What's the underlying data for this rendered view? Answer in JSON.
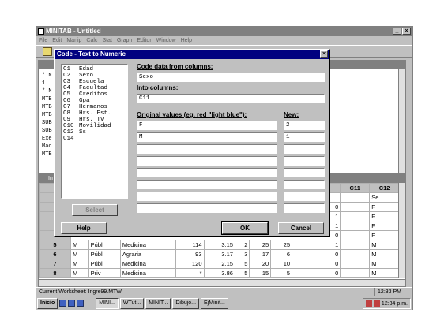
{
  "app": {
    "title": "MINITAB - Untitled",
    "window_buttons": [
      "_",
      "×"
    ],
    "menu": [
      "File",
      "Edit",
      "Manip",
      "Calc",
      "Stat",
      "Graph",
      "Editor",
      "Window",
      "Help"
    ]
  },
  "session": {
    "lines": [
      "* N",
      "  1",
      "* N",
      "MTB",
      "MTB",
      "MTB",
      "SUB",
      "SUB",
      "Exe",
      "Mac",
      "MTB"
    ]
  },
  "worksheet": {
    "title": "In",
    "col_headers": [
      "C10",
      "C11",
      "C12"
    ],
    "col_names": [
      "ovilidad",
      "",
      "Se"
    ],
    "partial_rows": [
      {
        "c10": "0",
        "c12": "F"
      },
      {
        "c10": "1",
        "c12": "F"
      },
      {
        "c10": "1",
        "c12": "F"
      },
      {
        "c10": "0",
        "c12": "F"
      }
    ],
    "rows": [
      {
        "num": "5",
        "c1": "M",
        "c2": "Públ",
        "c3": "Medicina",
        "c4": "114",
        "c5": "3.15",
        "c6": "2",
        "c7": "25",
        "c8": "25",
        "c10": "1",
        "c12": "M"
      },
      {
        "num": "6",
        "c1": "M",
        "c2": "Públ",
        "c3": "Agraria",
        "c4": "93",
        "c5": "3.17",
        "c6": "3",
        "c7": "17",
        "c8": "6",
        "c10": "0",
        "c12": "M"
      },
      {
        "num": "7",
        "c1": "M",
        "c2": "Públ",
        "c3": "Medicina",
        "c4": "120",
        "c5": "2.15",
        "c6": "5",
        "c7": "20",
        "c8": "10",
        "c10": "0",
        "c12": "M"
      },
      {
        "num": "8",
        "c1": "M",
        "c2": "Priv",
        "c3": "Medicina",
        "c4": "*",
        "c5": "3.86",
        "c6": "5",
        "c7": "15",
        "c8": "5",
        "c10": "0",
        "c12": "M"
      }
    ]
  },
  "status": {
    "text": "Current Worksheet: Ingre99.MTW",
    "time": "12:33 PM"
  },
  "taskbar": {
    "start": "Inicio",
    "tasks": [
      "MINI...",
      "WTut...",
      "MINIT...",
      "Dibujo...",
      "EjMinit..."
    ],
    "clock": "12:34 p.m."
  },
  "dialog": {
    "title": "Code - Text to Numeric",
    "close": "×",
    "columns": [
      {
        "id": "C1",
        "name": "Edad"
      },
      {
        "id": "C2",
        "name": "Sexo"
      },
      {
        "id": "C3",
        "name": "Escuela"
      },
      {
        "id": "C4",
        "name": "Facultad"
      },
      {
        "id": "C5",
        "name": "Creditos"
      },
      {
        "id": "C6",
        "name": "Gpa"
      },
      {
        "id": "C7",
        "name": "Hermanos"
      },
      {
        "id": "C8",
        "name": "Hrs. Est."
      },
      {
        "id": "C9",
        "name": "Hrs. TV"
      },
      {
        "id": "C10",
        "name": "Movilidad"
      },
      {
        "id": "C12",
        "name": "Ss"
      },
      {
        "id": "C14",
        "name": ""
      }
    ],
    "code_from_label": "Code data from columns:",
    "code_from_value": "Sexo",
    "into_label": "Into columns:",
    "into_value": "C11",
    "original_label": "Original values (eg,  red  \"light blue\"):",
    "new_label": "New:",
    "mappings": [
      {
        "orig": "F",
        "new": "2"
      },
      {
        "orig": "M",
        "new": "1"
      },
      {
        "orig": "",
        "new": ""
      },
      {
        "orig": "",
        "new": ""
      },
      {
        "orig": "",
        "new": ""
      },
      {
        "orig": "",
        "new": ""
      },
      {
        "orig": "",
        "new": ""
      },
      {
        "orig": "",
        "new": ""
      }
    ],
    "select_label": "Select",
    "help_label": "Help",
    "ok_label": "OK",
    "cancel_label": "Cancel"
  }
}
